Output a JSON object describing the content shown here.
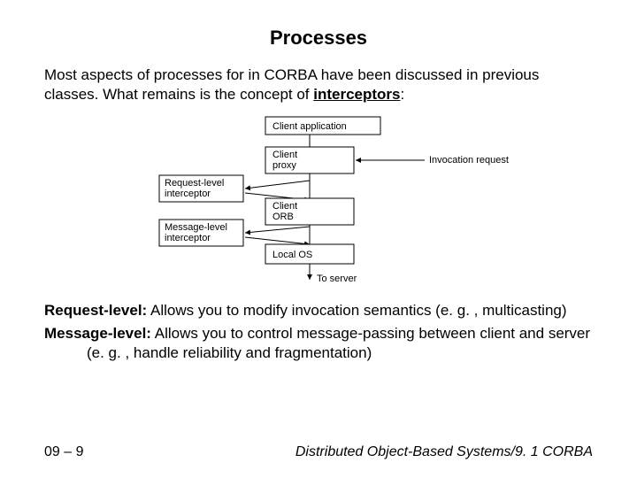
{
  "title": "Processes",
  "intro_pre": "Most aspects of processes for in CORBA have been discussed in previous classes. What remains is the concept of ",
  "intro_underlined": "interceptors",
  "intro_post": ":",
  "diagram": {
    "client_app": "Client application",
    "client_proxy_l1": "Client",
    "client_proxy_l2": "proxy",
    "client_orb_l1": "Client",
    "client_orb_l2": "ORB",
    "local_os": "Local OS",
    "req_int_l1": "Request-level",
    "req_int_l2": "interceptor",
    "msg_int_l1": "Message-level",
    "msg_int_l2": "interceptor",
    "invocation": "Invocation request",
    "to_server": "To server"
  },
  "request_level_label": "Request-level:",
  "request_level_text": " Allows you to modify invocation semantics (e. g. , multicasting)",
  "message_level_label": "Message-level:",
  "message_level_text": " Allows you to control message-passing between client and server (e. g. , handle reliability and fragmentation)",
  "footer_page": "09 – 9",
  "footer_course": "Distributed Object-Based Systems/9. 1 CORBA"
}
